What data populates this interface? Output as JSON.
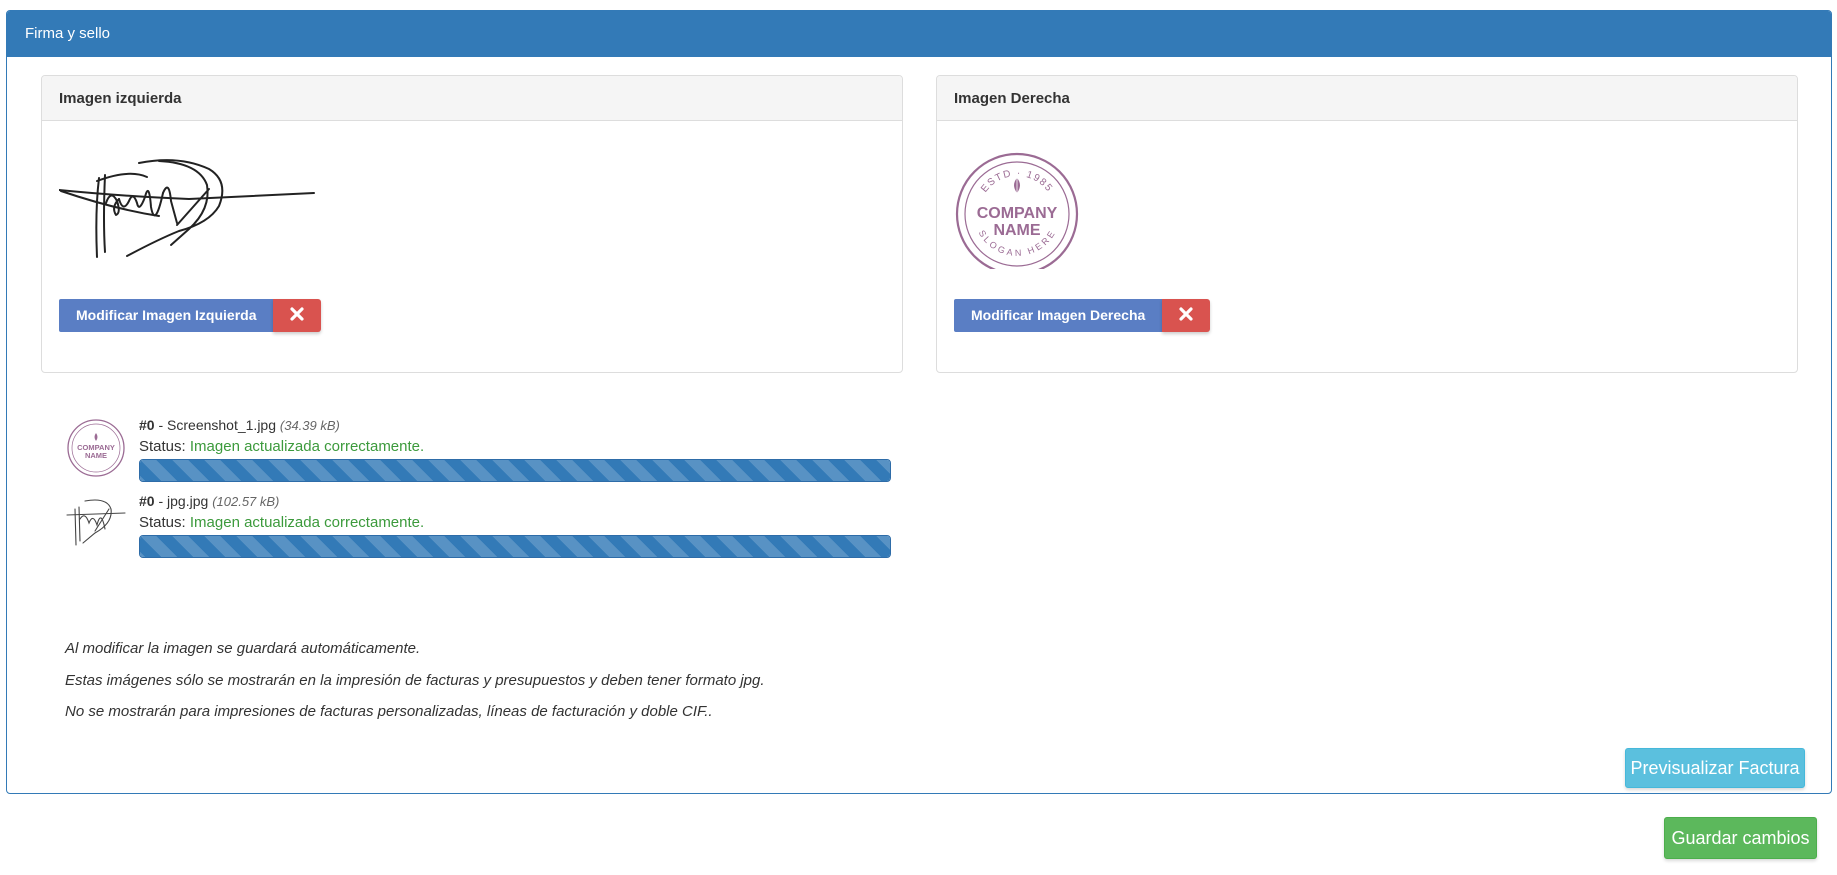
{
  "panel": {
    "title": "Firma y sello"
  },
  "left_image": {
    "heading": "Imagen izquierda",
    "modify_label": "Modificar Imagen Izquierda",
    "remove_icon": "close-icon"
  },
  "right_image": {
    "heading": "Imagen Derecha",
    "modify_label": "Modificar Imagen Derecha",
    "remove_icon": "close-icon",
    "stamp": {
      "top_text": "ESTD · 1985",
      "line1": "COMPANY",
      "line2": "NAME",
      "bottom_text": "SLOGAN HERE"
    }
  },
  "uploads": [
    {
      "index": "#0",
      "separator": " - ",
      "filename": "Screenshot_1.jpg",
      "size": "(34.39 kB)",
      "status_label": "Status:",
      "status_text": "Imagen actualizada correctamente.",
      "progress": 1.0
    },
    {
      "index": "#0",
      "separator": " - ",
      "filename": "jpg.jpg",
      "size": "(102.57 kB)",
      "status_label": "Status:",
      "status_text": "Imagen actualizada correctamente.",
      "progress": 1.0
    }
  ],
  "notes": [
    "Al modificar la imagen se guardará automáticamente.",
    "Estas imágenes sólo se mostrarán en la impresión de facturas y presupuestos y deben tener formato jpg.",
    "No se mostrarán para impresiones de facturas personalizadas, líneas de facturación y doble CIF.."
  ],
  "actions": {
    "preview_label": "Previsualizar Factura",
    "save_label": "Guardar cambios"
  },
  "colors": {
    "primary": "#337ab7",
    "modify_button": "#5a7ec4",
    "danger": "#d9534f",
    "info": "#5bc0de",
    "success": "#5cb85c",
    "status_ok": "#3c9a3c",
    "stamp": "#9b6b94"
  }
}
